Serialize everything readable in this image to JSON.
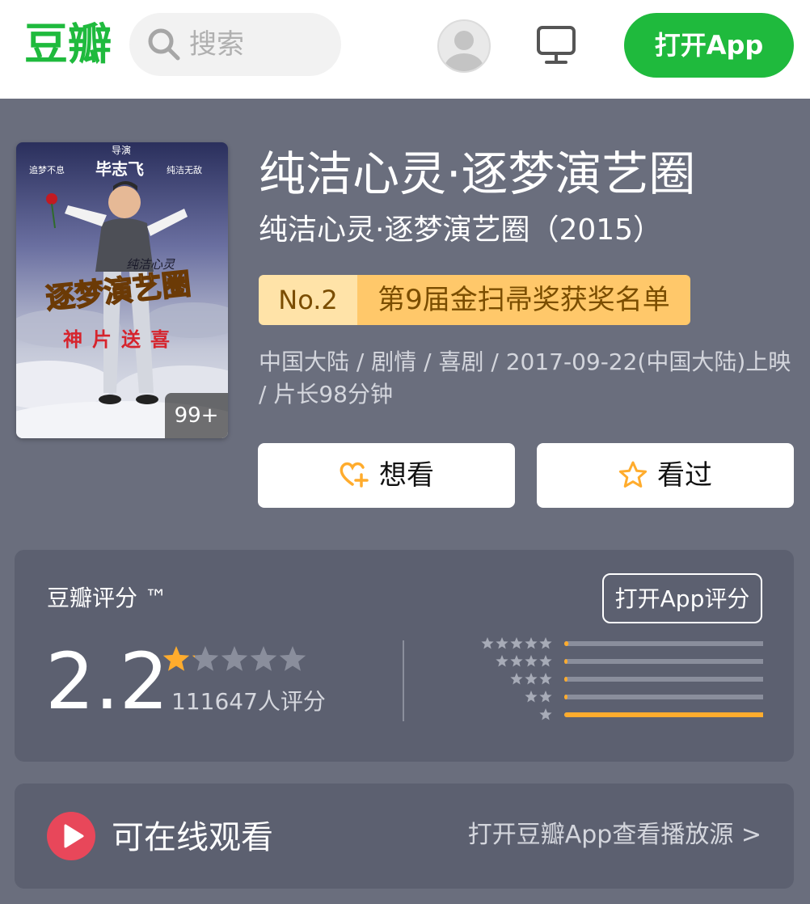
{
  "header": {
    "logo": "豆瓣",
    "search_placeholder": "搜索",
    "open_app": "打开App"
  },
  "poster": {
    "photo_count": "99+",
    "lines": {
      "director_label": "导演",
      "director": "毕志飞",
      "left_slogan": "追梦不息",
      "right_slogan": "纯洁无敌",
      "film_title": "逐梦演艺圈",
      "tagline": "神片送喜",
      "script_title": "纯洁心灵"
    }
  },
  "movie": {
    "title": "纯洁心灵·逐梦演艺圈",
    "subtitle": "纯洁心灵·逐梦演艺圈（2015）",
    "award_rank": "No.2",
    "award_name": "第9届金扫帚奖获奖名单",
    "meta": "中国大陆 / 剧情 / 喜剧 / 2017-09-22(中国大陆)上映 / 片长98分钟",
    "want_label": "想看",
    "seen_label": "看过"
  },
  "rating": {
    "label": "豆瓣评分 ™",
    "open_app_rate": "打开App评分",
    "score": "2.2",
    "stars_value": 1.1,
    "votes": "111647人评分",
    "distribution": [
      0.02,
      0.005,
      0.005,
      0.01,
      0.96
    ]
  },
  "watch": {
    "label": "可在线观看",
    "link": "打开豆瓣App查看播放源 >"
  },
  "colors": {
    "brand_green": "#1fba3d",
    "star_orange": "#ffac2d",
    "background": "#6a6e7d",
    "card": "#5c6070"
  }
}
